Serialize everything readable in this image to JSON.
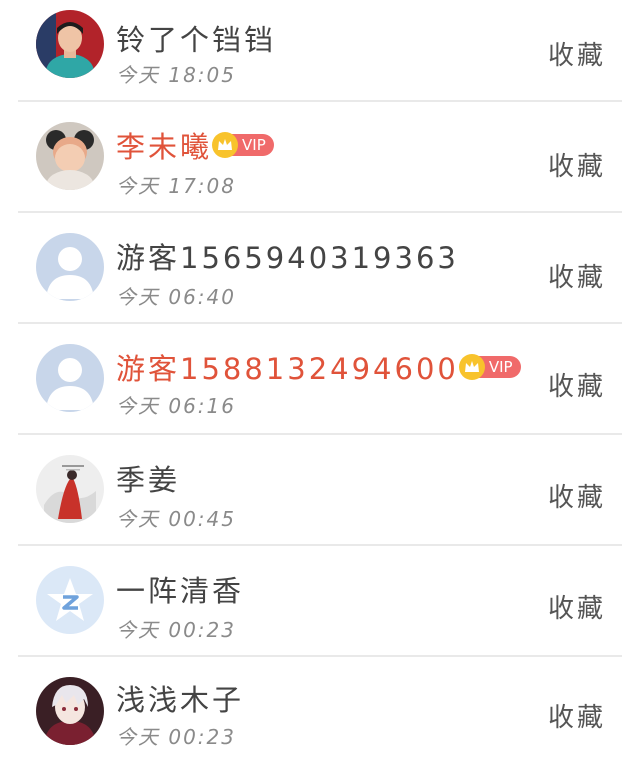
{
  "list": {
    "favorite_label": "收藏",
    "items": [
      {
        "name": "铃了个铛铛",
        "time": "今天 18:05",
        "vip": false,
        "avatar": "photo-boy-avatar"
      },
      {
        "name": "李未曦",
        "time": "今天 17:08",
        "vip": true,
        "vip_label": "VIP",
        "avatar": "photo-baby-avatar"
      },
      {
        "name": "游客1565940319363",
        "time": "今天 06:40",
        "vip": false,
        "avatar": "default-user-avatar"
      },
      {
        "name": "游客1588132494600",
        "time": "今天 06:16",
        "vip": true,
        "vip_label": "VIP",
        "avatar": "default-user-avatar"
      },
      {
        "name": "季姜",
        "time": "今天 00:45",
        "vip": false,
        "avatar": "painting-red-figure-avatar"
      },
      {
        "name": "一阵清香",
        "time": "今天 00:23",
        "vip": false,
        "avatar": "qq-star-avatar"
      },
      {
        "name": "浅浅木子",
        "time": "今天 00:23",
        "vip": false,
        "avatar": "anime-character-avatar"
      }
    ]
  },
  "colors": {
    "vip_name": "#e0533a",
    "vip_badge": "#f06a6a",
    "crown": "#f8c32c",
    "divider": "#e9e9e9"
  }
}
